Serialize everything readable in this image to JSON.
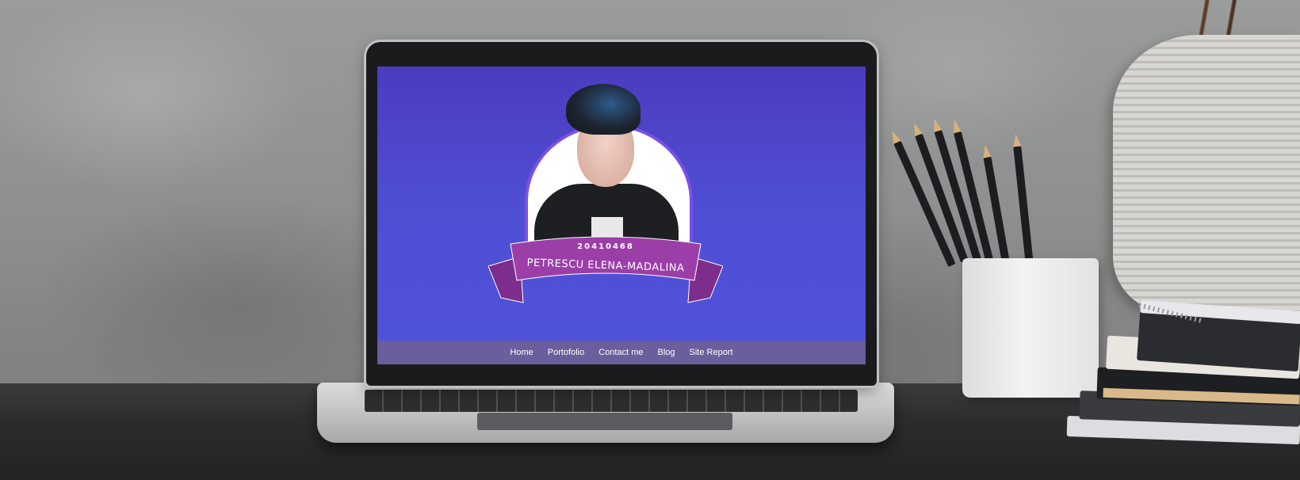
{
  "site": {
    "student_id": "20410468",
    "name": "PETRESCU ELENA-MADALINA"
  },
  "nav": {
    "items": [
      {
        "label": "Home"
      },
      {
        "label": "Portofolio"
      },
      {
        "label": "Contact me"
      },
      {
        "label": "Blog"
      },
      {
        "label": "Site Report"
      }
    ]
  },
  "colors": {
    "screen_bg_top": "#4c3cbf",
    "screen_bg_bottom": "#5152db",
    "ribbon": "#9b3ea8",
    "ring": "#7b4fe8",
    "nav_bar": "#6a5e9c"
  }
}
